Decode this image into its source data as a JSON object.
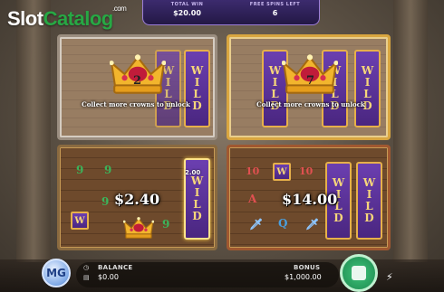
{
  "logo": {
    "slot": "Slot",
    "catalog": "Catalog",
    "com": ".com"
  },
  "topbar": {
    "total_win_label": "TOTAL WIN",
    "total_win_value": "$20.00",
    "free_spins_label": "FREE SPINS LEFT",
    "free_spins_value": "6"
  },
  "panels": {
    "top_left": {
      "count": "2",
      "message": "Collect more crowns to unlock"
    },
    "top_right": {
      "count": "7",
      "message": "Collect more crowns to unlock"
    },
    "bottom_left": {
      "win": "$2.40",
      "small_win": "2.00",
      "symbols": {
        "nine_a": "9",
        "nine_b": "9",
        "nine_c": "9",
        "nine_d": "9",
        "w": "W"
      }
    },
    "bottom_right": {
      "win": "$14.00",
      "symbols": {
        "ten_a": "10",
        "ten_b": "10",
        "a": "A",
        "q": "Q",
        "w": "W"
      }
    },
    "wild_letters": [
      "W",
      "I",
      "L",
      "D"
    ]
  },
  "bottombar": {
    "avatar": "MG",
    "balance_label": "BALANCE",
    "balance_value": "$0.00",
    "bonus_label": "BONUS",
    "bonus_value": "$1,000.00"
  },
  "colors": {
    "wild_purple": "#5a2f98",
    "gold": "#e6b04a",
    "spin_green": "#2aa865",
    "logo_green": "#27a844"
  }
}
